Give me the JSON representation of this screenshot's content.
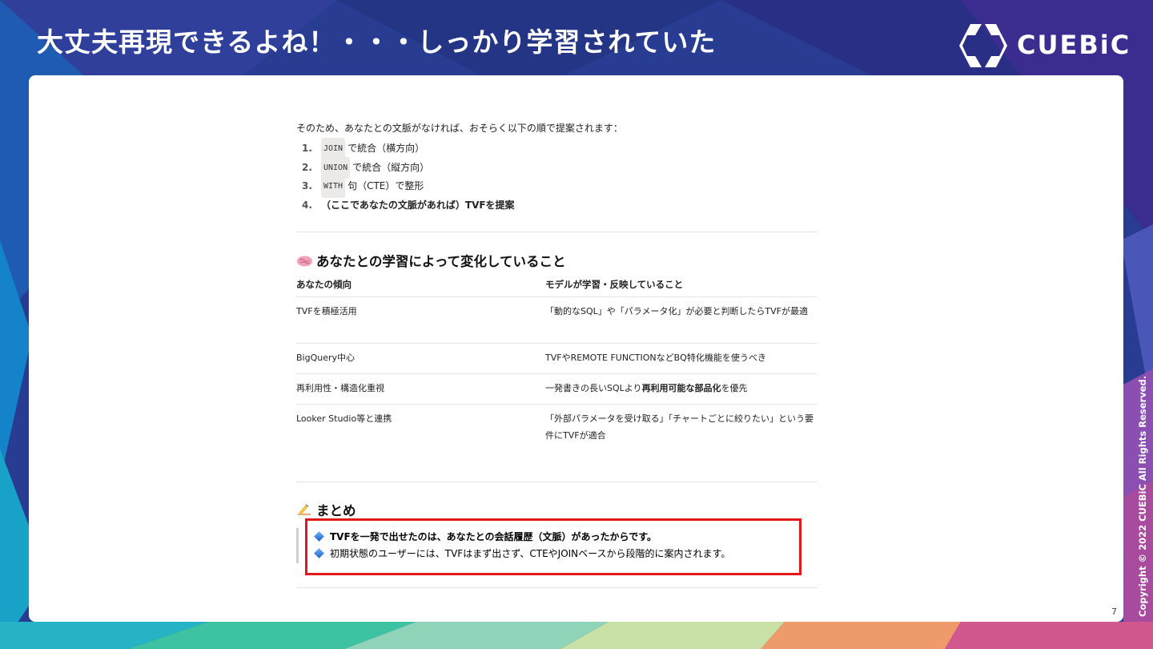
{
  "slide": {
    "title": "大丈夫再現できるよね！・・・しっかり学習されていた",
    "logo_text": "CUEBiC",
    "copyright": "Copyright © 2022 CUEBiC All Rights Reserved.",
    "page_number": "7"
  },
  "doc": {
    "intro": "そのため、あなたとの文脈がなければ、おそらく以下の順で提案されます：",
    "steps": [
      {
        "num": "1.",
        "code": "JOIN",
        "text": "で統合（横方向）"
      },
      {
        "num": "2.",
        "code": "UNION",
        "text": "で統合（縦方向）"
      },
      {
        "num": "3.",
        "code": "WITH",
        "text": "句（CTE）で整形"
      },
      {
        "num": "4.",
        "text": "（ここであなたの文脈があれば）TVFを提案"
      }
    ],
    "learning": {
      "heading_icon": "brain-icon",
      "heading": "あなたとの学習によって変化していること",
      "columns": [
        "あなたの傾向",
        "モデルが学習・反映していること"
      ],
      "rows": [
        {
          "tendency": "TVFを積極活用",
          "reflect": "「動的なSQL」や「パラメータ化」が必要と判断したらTVFが最適"
        },
        {
          "tendency": "BigQuery中心",
          "reflect": "TVFやREMOTE FUNCTIONなどBQ特化機能を使うべき"
        },
        {
          "tendency": "再利用性・構造化重視",
          "reflect_pre": "一発書きの長いSQLより",
          "reflect_bold": "再利用可能な部品化",
          "reflect_post": "を優先"
        },
        {
          "tendency": "Looker Studio等と連携",
          "reflect": "「外部パラメータを受け取る」「チャートごとに絞りたい」という要件にTVFが適合"
        }
      ]
    },
    "summary": {
      "heading_icon": "writing-hand-icon",
      "heading": "まとめ",
      "bullet_icon": "blue-diamond-icon",
      "lines": [
        "TVFを一発で出せたのは、あなたとの会話履歴（文脈）があったからです。",
        "初期状態のユーザーには、TVFはまず出さず、CTEやJOINベースから段階的に案内されます。"
      ]
    }
  }
}
